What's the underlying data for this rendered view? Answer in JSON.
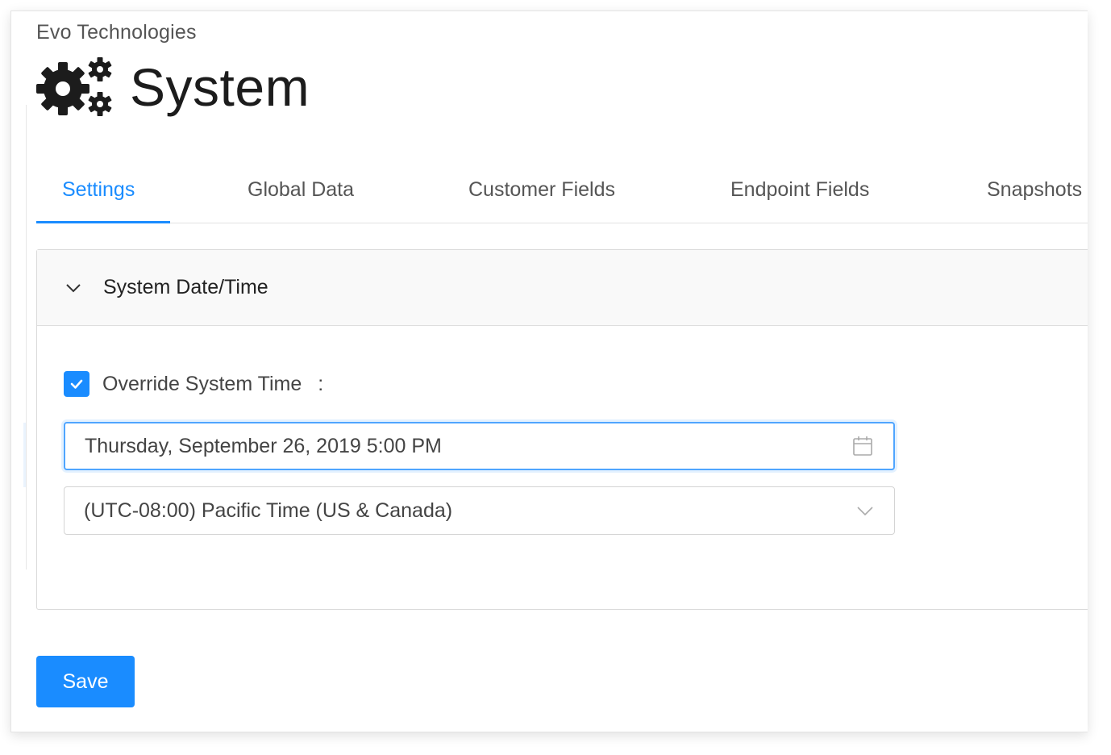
{
  "breadcrumb": "Evo Technologies",
  "page": {
    "title": "System",
    "icon": "gears-icon"
  },
  "tabs": [
    {
      "label": "Settings",
      "active": true
    },
    {
      "label": "Global Data",
      "active": false
    },
    {
      "label": "Customer Fields",
      "active": false
    },
    {
      "label": "Endpoint Fields",
      "active": false
    },
    {
      "label": "Snapshots",
      "active": false
    }
  ],
  "panel": {
    "title": "System Date/Time",
    "expanded": true,
    "override": {
      "label": "Override System Time",
      "colon": ":",
      "checked": true
    },
    "datetime": {
      "value": "Thursday, September 26, 2019 5:00 PM",
      "icon": "calendar-icon"
    },
    "timezone": {
      "value": "(UTC-08:00) Pacific Time (US & Canada)",
      "icon": "chevron-down-icon"
    }
  },
  "actions": {
    "save_label": "Save"
  },
  "colors": {
    "accent": "#1a8cff",
    "text": "#444444",
    "title": "#1c1c1c"
  }
}
